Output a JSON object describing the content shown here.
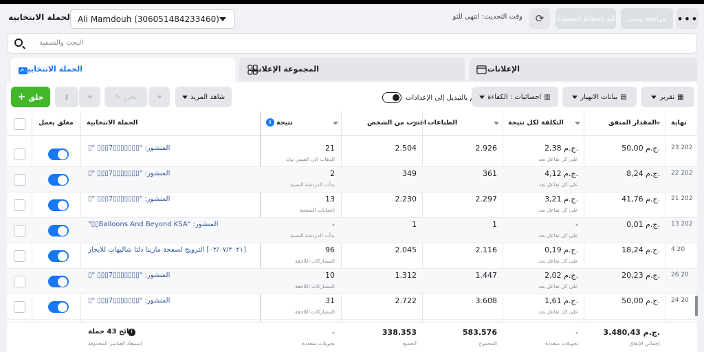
{
  "header": {
    "title": "الحملة الانتخابية",
    "account": "Ali Mamdouh (306051484233460)",
    "updated": "وقت التحديث: انتهى للتو",
    "discard_draft": "قم بإسقاط المسودة",
    "review_publish": "مراجعة ونشر",
    "more": "•••"
  },
  "search": {
    "placeholder": "البحث والتصفية"
  },
  "tabs": {
    "campaign": "الحملة الانتخابية",
    "adset": "المجموعة الإعلانية",
    "ads": "الإعلانات"
  },
  "toolbar": {
    "create": "خلق",
    "edit": "يحرر",
    "see_more": "شاهد المزيد",
    "switch_to_settings": "قم بالتبديل إلى الإعدادات",
    "stats": "احصائيات : الكفاءة",
    "breakdown": "بيانات الانهيار",
    "report": "تقرير"
  },
  "columns": {
    "off_on": "مغلق يعمل",
    "campaign": "الحملة الانتخابية",
    "result": "نتيجة",
    "reach": "اقترب من الشخص",
    "impressions": "الطباعات",
    "cost_per_result": "التكلفة لكل نتيجة",
    "amount_spent": "المقدار المنفق",
    "end": "نهاية"
  },
  "rows": [
    {
      "name": "المنشور: \"▯▯▯▯▯▯▯7▯▯▯ \"▯",
      "result": "21",
      "result_sub": "الذهاب إلى الفيس بوك",
      "reach": "2.504",
      "impressions": "2.926",
      "cost": "2,38 ج.م.",
      "cost_sub": "على كل تفاعل بعد",
      "spent": "50,00 ج.م.",
      "end": "23 202"
    },
    {
      "name": "المنشور: \"▯▯▯▯▯▯▯7▯▯▯ \"▯",
      "result": "2",
      "result_sub": "بدأت الدردشة النصية",
      "reach": "349",
      "impressions": "361",
      "cost": "4,12 ج.م.",
      "cost_sub": "على كل تفاعل بعد",
      "spent": "8,24 ج.م.",
      "end": "22 202"
    },
    {
      "name": "المنشور: \"▯▯▯▯▯▯▯7▯▯▯ \"▯",
      "result": "13",
      "result_sub": "إعجابات الصفحة",
      "reach": "2.230",
      "impressions": "2.297",
      "cost": "3,21 ج.م.",
      "cost_sub": "على كل تفاعل بعد",
      "spent": "41,76 ج.م.",
      "end": "21 202"
    },
    {
      "name": "المنشور: \"Balloons And Beyond KSA▯▯\"",
      "result": "-",
      "result_sub": "بدأت الدردشة النصية",
      "reach": "1",
      "impressions": "1",
      "cost": "-",
      "cost_sub": "على كل تفاعل بعد",
      "spent": "0,01 ج.م.",
      "end": "13 202"
    },
    {
      "name": "[٠٣/٠٧/٢٠٢١] الترويج لصفحة مارينا دلتا شاليهات للايجار",
      "result": "96",
      "result_sub": "المشاركات اللاحقة",
      "reach": "2.045",
      "impressions": "2.116",
      "cost": "0,19 ج.م.",
      "cost_sub": "على كل تفاعل بعد",
      "spent": "18,24 ج.م.",
      "end": "4 20"
    },
    {
      "name": "المنشور: \"▯▯▯▯▯▯▯7▯▯▯ \"▯",
      "result": "10",
      "result_sub": "المشاركات اللاحقة",
      "reach": "1.312",
      "impressions": "1.447",
      "cost": "2,02 ج.م.",
      "cost_sub": "على كل تفاعل بعد",
      "spent": "20,23 ج.م.",
      "end": "26 20"
    },
    {
      "name": "المنشور: \"▯▯▯▯▯▯▯7▯▯▯ \"▯",
      "result": "31",
      "result_sub": "المشاركات اللاحقة",
      "reach": "2.722",
      "impressions": "3.608",
      "cost": "1,61 ج.م.",
      "cost_sub": "على كل تفاعل بعد",
      "spent": "50,00 ج.م.",
      "end": "24 20"
    }
  ],
  "footer": {
    "campaigns": "نتائج 43 حملة",
    "campaigns_sub": "استبعاد العناصر المحذوفة",
    "result": "-",
    "result_sub": "تحويلات متعددة",
    "reach": "338.353",
    "reach_sub": "الجميع",
    "impressions": "583.576",
    "impressions_sub": "المجموع",
    "cost": "-",
    "cost_sub": "تحويلات متعددة",
    "spent": "3.480,43 ج.م.",
    "spent_sub": "إجمالي الإنفاق"
  },
  "colors": {
    "accent": "#1877f2",
    "create": "#42b72a",
    "link": "#385898"
  }
}
